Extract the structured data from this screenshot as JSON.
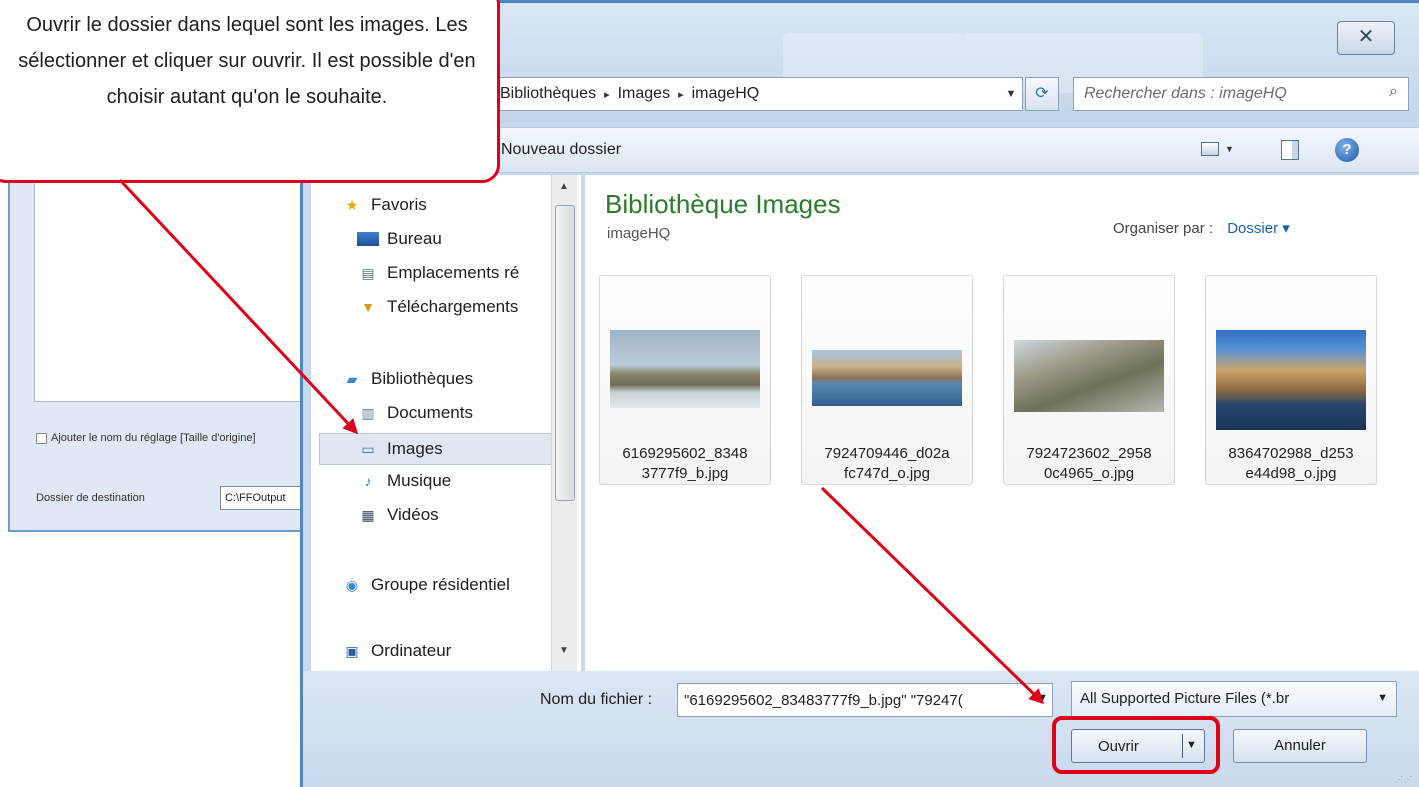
{
  "background_app": {
    "checkbox_label": "Ajouter le nom du réglage [Taille d'origine]",
    "dest_label": "Dossier de destination",
    "dest_value": "C:\\FFOutput"
  },
  "callout": {
    "text": "Ouvrir le dossier dans lequel sont les images. Les sélectionner et cliquer sur ouvrir. Il est possible d'en choisir autant qu'on le souhaite."
  },
  "dialog": {
    "close_glyph": "✕",
    "address": {
      "crumbs": [
        "Bibliothèques",
        "Images",
        "imageHQ"
      ],
      "separator": "▸"
    },
    "search": {
      "placeholder": "Rechercher dans : imageHQ"
    },
    "toolbar": {
      "new_folder": "Nouveau dossier",
      "help_glyph": "?"
    },
    "nav": {
      "favoris": "Favoris",
      "bureau": "Bureau",
      "emplacements": "Emplacements ré",
      "telechargements": "Téléchargements",
      "bibliotheques": "Bibliothèques",
      "documents": "Documents",
      "images": "Images",
      "musique": "Musique",
      "videos": "Vidéos",
      "groupe": "Groupe résidentiel",
      "ordinateur": "Ordinateur"
    },
    "content": {
      "title": "Bibliothèque Images",
      "subtitle": "imageHQ",
      "arrange_label": "Organiser par :",
      "arrange_value": "Dossier",
      "files": [
        {
          "line1": "6169295602_8348",
          "line2": "3777f9_b.jpg"
        },
        {
          "line1": "7924709446_d02a",
          "line2": "fc747d_o.jpg"
        },
        {
          "line1": "7924723602_2958",
          "line2": "0c4965_o.jpg"
        },
        {
          "line1": "8364702988_d253",
          "line2": "e44d98_o.jpg"
        }
      ]
    },
    "footer": {
      "filename_label": "Nom du fichier :",
      "filename_value": "\"6169295602_83483777f9_b.jpg\" \"79247(",
      "filter_value": "All Supported Picture Files (*.br",
      "open_label": "Ouvrir",
      "cancel_label": "Annuler"
    }
  },
  "colors": {
    "annotation_red": "#e0001a",
    "title_green": "#2b7d2b",
    "link_blue": "#1a5fb0",
    "frame_blue": "#4f86c6"
  }
}
